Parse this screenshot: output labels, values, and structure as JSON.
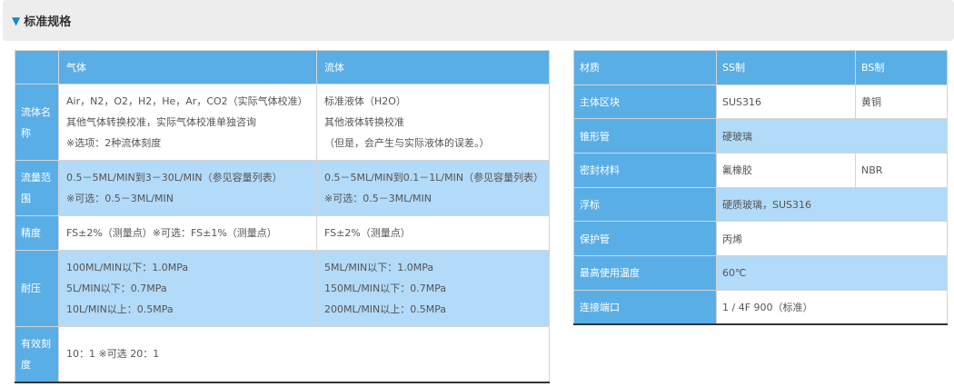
{
  "section": {
    "arrow": "▼",
    "title": "标准规格"
  },
  "left_table": {
    "headers": [
      "",
      "气体",
      "流体"
    ],
    "rows": [
      {
        "label": "流体名称",
        "gas": [
          "Air，N2，O2，H2，He，Ar，CO2（实际气体校准）",
          "其他气体转换校准，实际气体校准单独咨询",
          "※选项：2种流体刻度"
        ],
        "liquid": [
          "标准液体（H2O）",
          "其他液体转换校准",
          "（但是，会产生与实际液体的误差。）"
        ]
      },
      {
        "label": "流量范围",
        "gas": [
          "0.5－5ML/MIN到3－30L/MIN（参见容量列表）",
          "※可选：0.5－3ML/MIN"
        ],
        "liquid": [
          "0.5－5ML/MIN到0.1－1L/MIN（参见容量列表）",
          "※可选：0.5－3ML/MIN"
        ]
      },
      {
        "label": "精度",
        "gas": [
          "FS±2%（测量点）※可选：FS±1%（测量点）"
        ],
        "liquid": [
          "FS±2%（测量点）"
        ]
      },
      {
        "label": "耐压",
        "gas": [
          "100ML/MIN以下：1.0MPa",
          "5L/MIN以下：0.7MPa",
          "10L/MIN以上：0.5MPa"
        ],
        "liquid": [
          "5ML/MIN以下：1.0MPa",
          "150ML/MIN以下：0.7MPa",
          "200ML/MIN以上：0.5MPa"
        ]
      },
      {
        "label": "有效刻度",
        "merged": "10：1 ※可选 20：1"
      }
    ]
  },
  "right_table": {
    "headers": [
      "材质",
      "SS制",
      "BS制"
    ],
    "rows": [
      {
        "label": "主体区块",
        "ss": "SUS316",
        "bs": "黄铜"
      },
      {
        "label": "锥形管",
        "merged": "硬玻璃"
      },
      {
        "label": "密封材料",
        "ss": "氟橡胶",
        "bs": "NBR"
      },
      {
        "label": "浮标",
        "merged": "硬质玻璃，SUS316"
      },
      {
        "label": "保护管",
        "merged": "丙烯"
      },
      {
        "label": "最高使用温度",
        "merged": "60℃"
      },
      {
        "label": "连接端口",
        "merged": "1 / 4F 900（标准）"
      }
    ]
  }
}
